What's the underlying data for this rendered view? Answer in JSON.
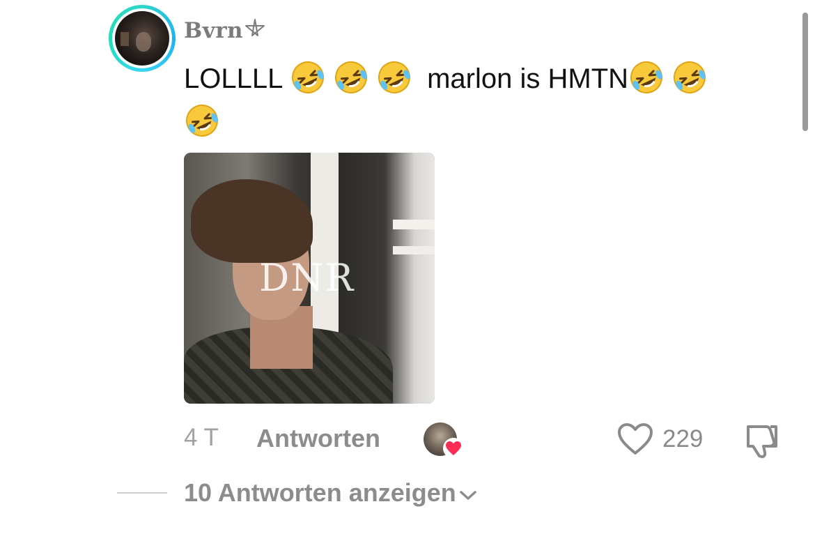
{
  "comment": {
    "username": "Bvrn",
    "username_symbol_icon": "pentagram-icon",
    "text_first": "LOLLLL",
    "text_middle": "marlon is HMTN",
    "emoji_icon": "rolling-on-floor-laughing-emoji",
    "image_watermark": "DNR",
    "time": "4 T",
    "reply_label": "Antworten",
    "like_count": "229"
  },
  "replies": {
    "view_label": "10 Antworten anzeigen"
  },
  "colors": {
    "avatar_ring": "#1fb3f0",
    "creator_heart": "#fe2c55",
    "muted_text": "#8c8c8c"
  }
}
